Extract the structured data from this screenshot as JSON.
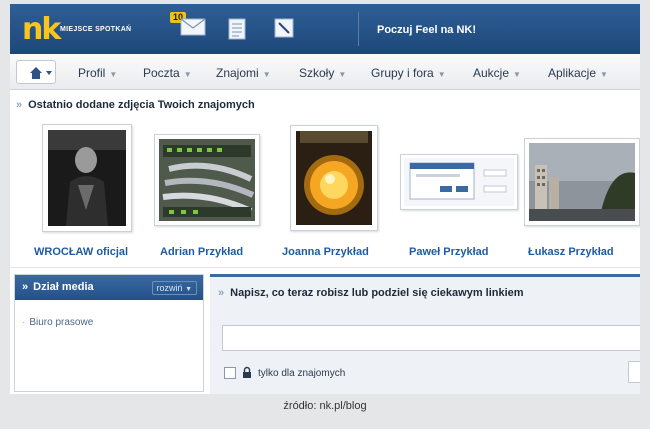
{
  "header": {
    "logo": "nk",
    "tagline": "MIEJSCE SPOTKAŃ",
    "mail_count": "10",
    "promo": "Poczuj Feel na NK!"
  },
  "nav": {
    "items": [
      {
        "label": "Profil"
      },
      {
        "label": "Poczta"
      },
      {
        "label": "Znajomi"
      },
      {
        "label": "Szkoły"
      },
      {
        "label": "Grupy i fora"
      },
      {
        "label": "Aukcje"
      },
      {
        "label": "Aplikacje"
      }
    ]
  },
  "photos_section": {
    "title": "Ostatnio dodane zdjęcia Twoich znajomych",
    "photos": [
      {
        "name": "WROCŁAW oficjal"
      },
      {
        "name": "Adrian Przykład"
      },
      {
        "name": "Joanna Przykład"
      },
      {
        "name": "Paweł Przykład"
      },
      {
        "name": "Łukasz Przykład"
      }
    ]
  },
  "media": {
    "title": "Dział media",
    "expand": "rozwiń",
    "links": [
      "Biuro prasowe"
    ]
  },
  "status": {
    "title": "Napisz, co teraz robisz lub podziel się ciekawym linkiem",
    "input_value": "",
    "friends_only_label": "tylko dla znajomych"
  },
  "caption": "źródło: nk.pl/blog"
}
